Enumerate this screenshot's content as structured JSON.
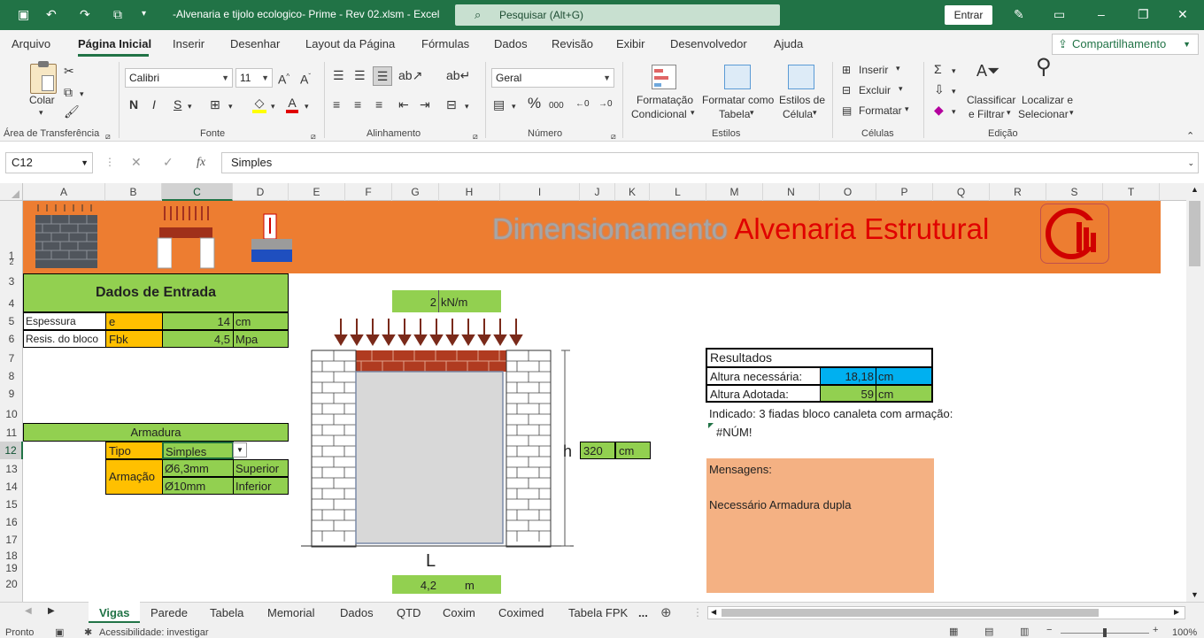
{
  "window": {
    "title": "-Alvenaria e tijolo ecologico- Prime - Rev 02.xlsm  -  Excel",
    "search_placeholder": "Pesquisar (Alt+G)",
    "signin": "Entrar"
  },
  "menu": {
    "items": [
      "Arquivo",
      "Página Inicial",
      "Inserir",
      "Desenhar",
      "Layout da Página",
      "Fórmulas",
      "Dados",
      "Revisão",
      "Exibir",
      "Desenvolvedor",
      "Ajuda"
    ],
    "share": "Compartilhamento"
  },
  "ribbon": {
    "clipboard": {
      "paste": "Colar",
      "group": "Área de Transferência"
    },
    "font": {
      "name": "Calibri",
      "size": "11",
      "bold": "N",
      "italic": "I",
      "underline": "S",
      "group": "Fonte"
    },
    "alignment": {
      "group": "Alinhamento"
    },
    "number": {
      "format": "Geral",
      "group": "Número"
    },
    "styles": {
      "cond1": "Formatação",
      "cond2": "Condicional",
      "table1": "Formatar como",
      "table2": "Tabela",
      "cell1": "Estilos de",
      "cell2": "Célula",
      "group": "Estilos"
    },
    "cells": {
      "insert": "Inserir",
      "delete": "Excluir",
      "format": "Formatar",
      "group": "Células"
    },
    "editing": {
      "sort1": "Classificar",
      "sort2": "e Filtrar",
      "find1": "Localizar e",
      "find2": "Selecionar",
      "group": "Edição"
    }
  },
  "formula_bar": {
    "cell_ref": "C12",
    "fx": "fx",
    "content": "Simples"
  },
  "columns": [
    "A",
    "B",
    "C",
    "D",
    "E",
    "F",
    "G",
    "H",
    "I",
    "J",
    "K",
    "L",
    "M",
    "N",
    "O",
    "P",
    "Q",
    "R",
    "S",
    "T"
  ],
  "rows": [
    "1",
    "2",
    "3",
    "4",
    "5",
    "6",
    "7",
    "8",
    "9",
    "10",
    "11",
    "12",
    "13",
    "14",
    "15",
    "16",
    "17",
    "18",
    "19",
    "20"
  ],
  "sheet": {
    "banner": {
      "title_grey": "Dimensionamento",
      "title_red": "Alvenaria Estrutural"
    },
    "input": {
      "header": "Dados de Entrada",
      "thickness": {
        "label": "Espessura",
        "symbol": "e",
        "value": "14",
        "unit": "cm"
      },
      "block": {
        "label": "Resis. do bloco",
        "symbol": "Fbk",
        "value": "4,5",
        "unit": "Mpa"
      }
    },
    "reinforcement": {
      "header": "Armadura",
      "type_label": "Tipo",
      "type_value": "Simples",
      "label": "Armação",
      "bar1": "Ø6,3mm",
      "pos1": "Superior",
      "bar2": "Ø10mm",
      "pos2": "Inferior"
    },
    "drawing": {
      "load_value": "2",
      "load_unit": "kN/m",
      "h_label": "h",
      "h_value": "320",
      "h_unit": "cm",
      "L_label": "L",
      "L_value": "4,2",
      "L_unit": "m"
    },
    "results": {
      "header": "Resultados",
      "needed_label": "Altura necessária:",
      "needed_value": "18,18",
      "needed_unit": "cm",
      "adopted_label": "Altura Adotada:",
      "adopted_value": "59",
      "adopted_unit": "cm",
      "note": "Indicado: 3 fiadas bloco canaleta com armação:",
      "error": "#NÚM!"
    },
    "messages": {
      "title": "Mensagens:",
      "text": "Necessário Armadura dupla"
    }
  },
  "tabs": [
    "Vigas",
    "Parede",
    "Tabela",
    "Memorial",
    "Dados",
    "QTD",
    "Coxim",
    "Coximed",
    "Tabela FPK",
    "..."
  ],
  "status": {
    "ready": "Pronto",
    "accessibility": "Acessibilidade: investigar",
    "zoom": "100%"
  },
  "colors": {
    "excel_green": "#217346",
    "banner_orange": "#ed7d31",
    "cell_green": "#92d050",
    "cell_orange": "#ffc000",
    "cell_blue": "#00b0f0",
    "message_bg": "#f4b183",
    "title_red": "#e00000"
  }
}
